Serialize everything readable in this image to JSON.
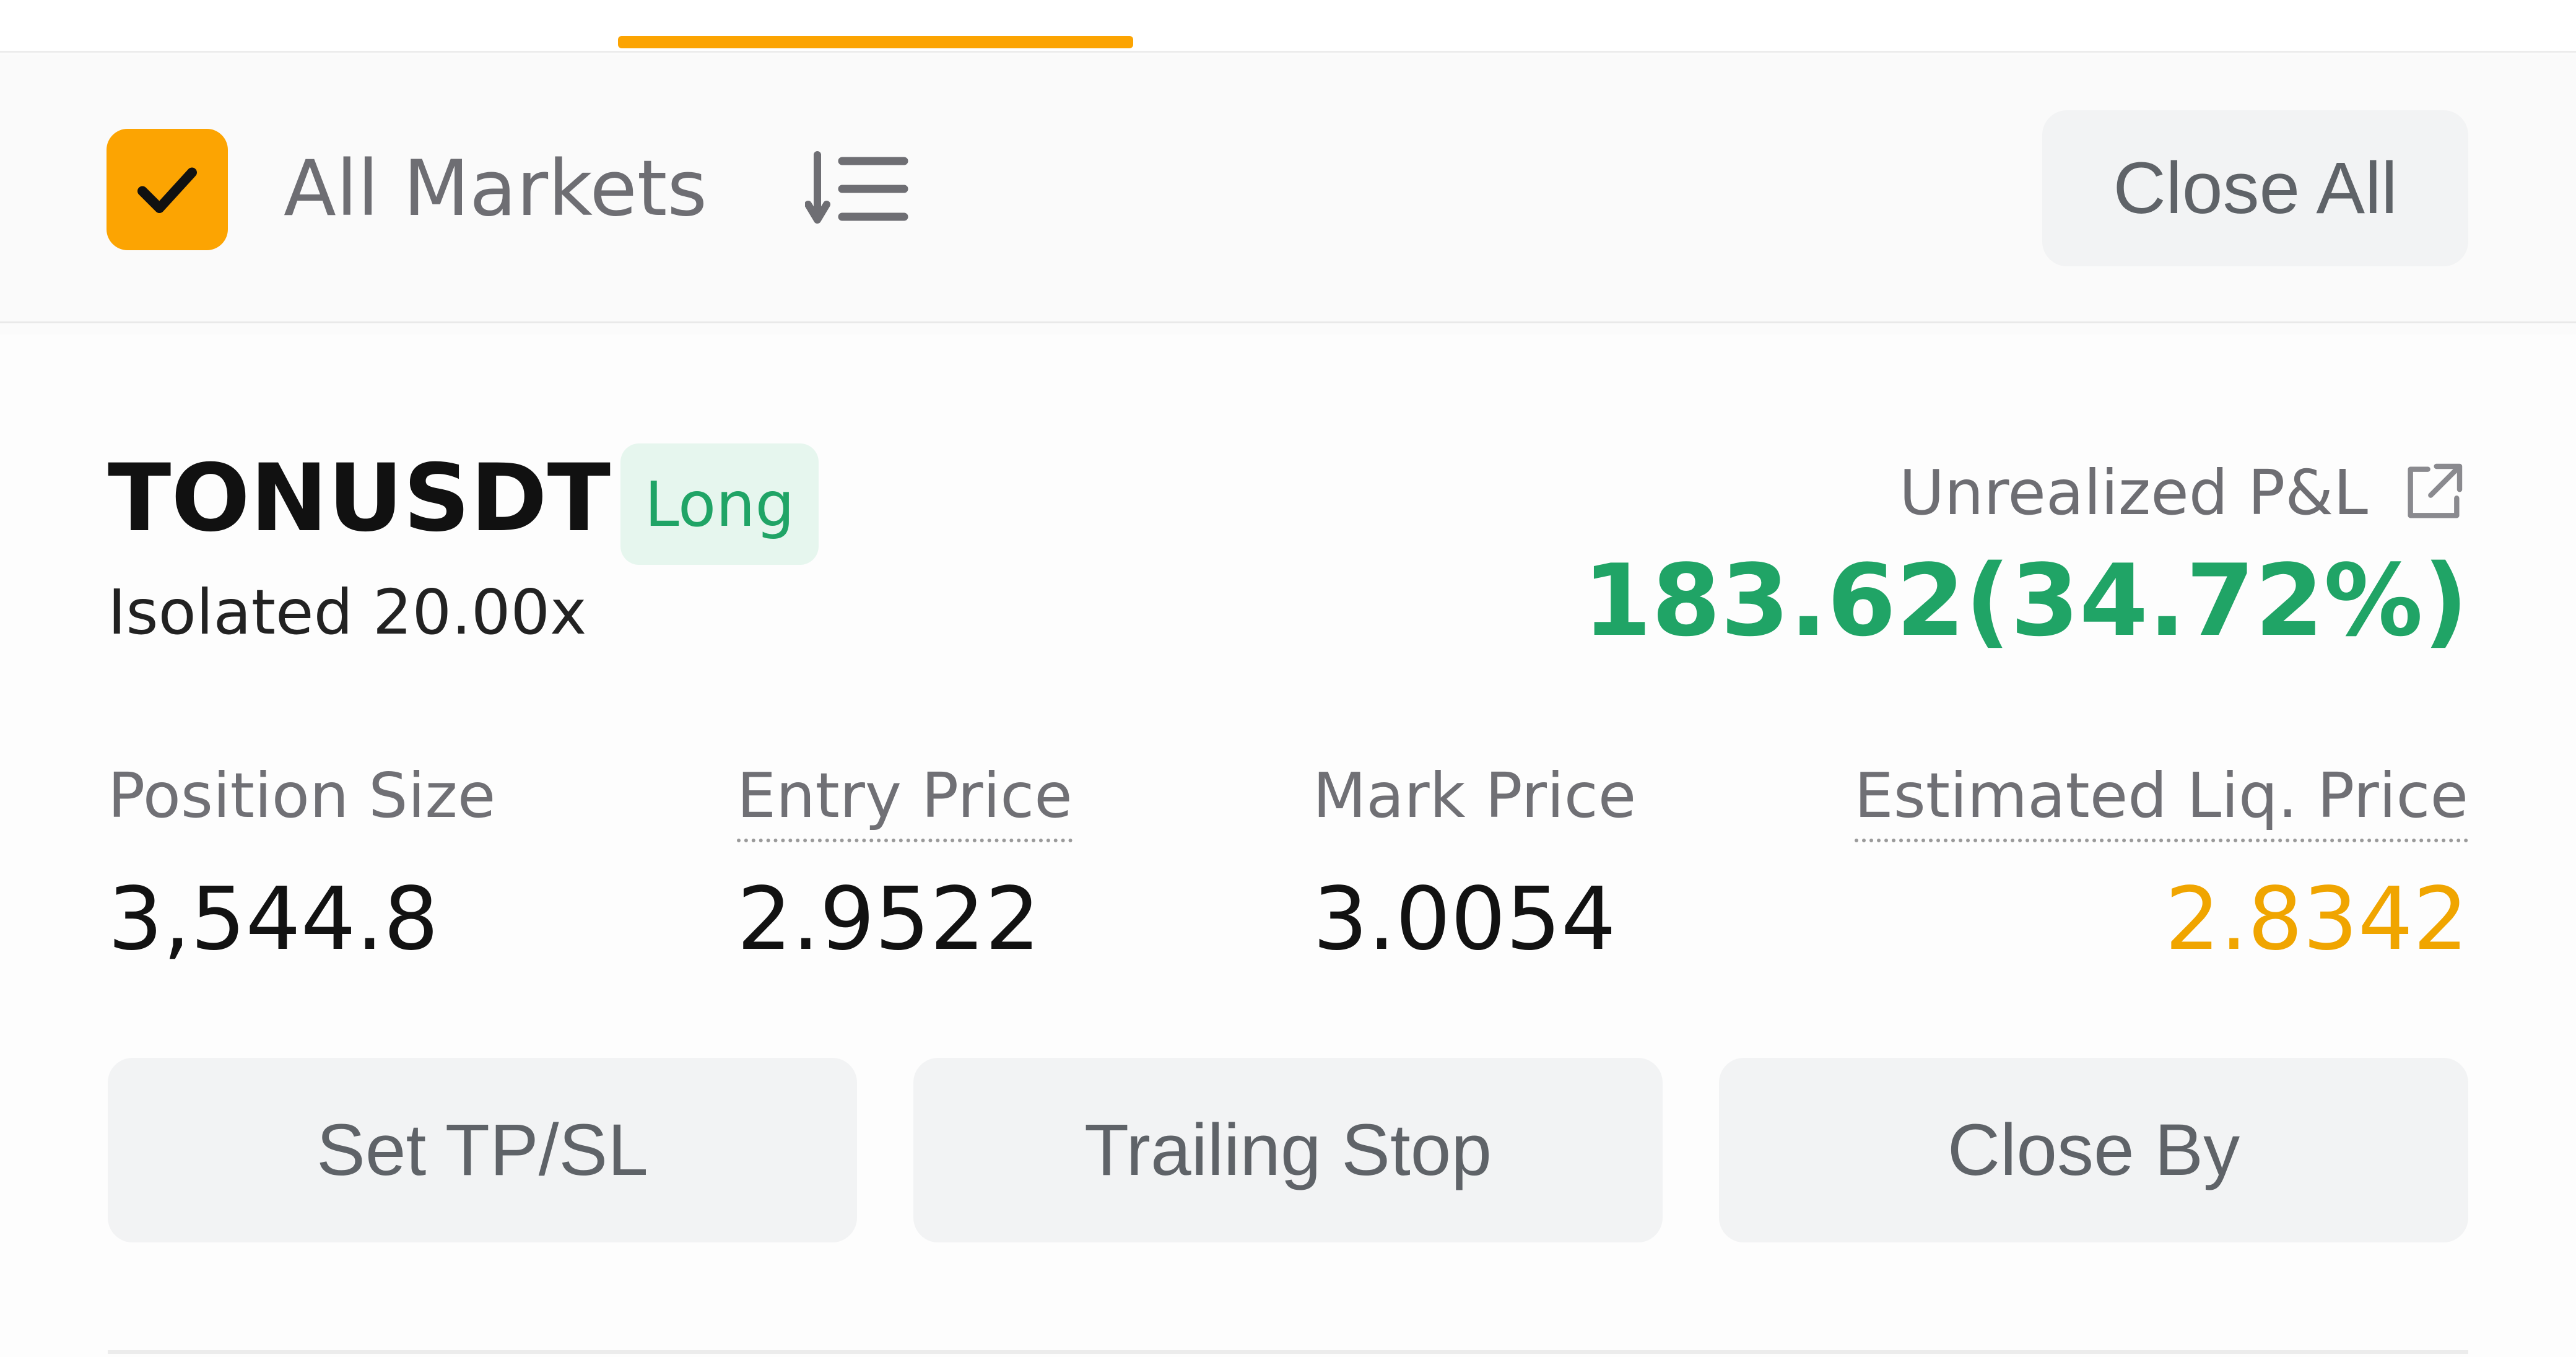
{
  "theme": {
    "accent": "#fca402",
    "positive": "#20a466",
    "warning": "#f0a500"
  },
  "filter_bar": {
    "all_markets_checked": true,
    "all_markets_label": "All Markets",
    "sort_icon": "sort-list-icon",
    "close_all_label": "Close All"
  },
  "position": {
    "symbol": "TONUSDT",
    "side": "Long",
    "margin_mode": "Isolated 20.00x",
    "unrealized_pnl_label": "Unrealized P&L",
    "share_icon": "share-external-icon",
    "unrealized_pnl_value": "183.62(34.72%)",
    "stats": {
      "size_label": "Position Size",
      "size_value": "3,544.8",
      "entry_label": "Entry Price",
      "entry_value": "2.9522",
      "mark_label": "Mark Price",
      "mark_value": "3.0054",
      "liq_label": "Estimated Liq. Price",
      "liq_value": "2.8342"
    },
    "actions": {
      "tpsl_label": "Set TP/SL",
      "trailing_label": "Trailing Stop",
      "close_by_label": "Close By"
    }
  }
}
